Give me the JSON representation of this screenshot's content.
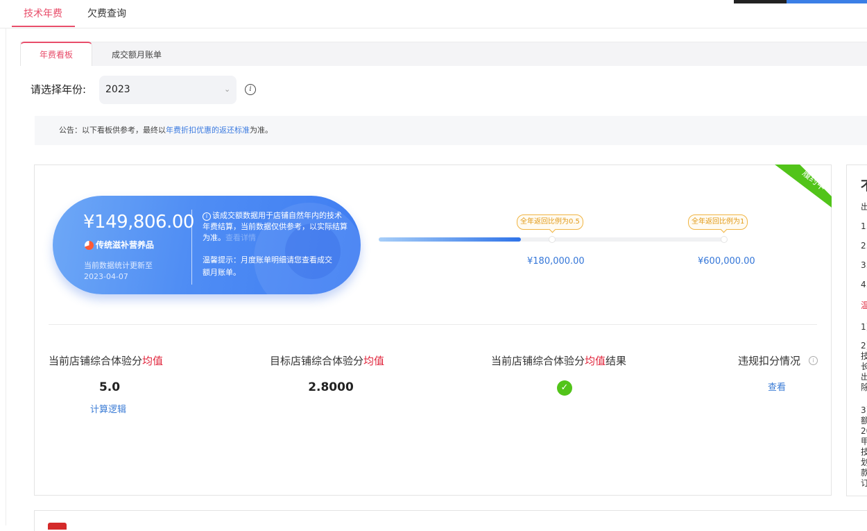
{
  "tabs": {
    "main": [
      {
        "label": "技术年费",
        "active": true
      },
      {
        "label": "欠费查询",
        "active": false
      }
    ],
    "sub": [
      {
        "label": "年费看板",
        "active": true
      },
      {
        "label": "成交额月账单",
        "active": false
      }
    ]
  },
  "year_filter": {
    "label": "请选择年份:",
    "value": "2023"
  },
  "notice": {
    "prefix": "公告：以下看板供参考，最终以",
    "link": "年费折扣优惠的返还标准",
    "suffix": "为准。"
  },
  "status_ribbon": "履约中",
  "summary": {
    "amount": "¥149,806.00",
    "brand": "传统滋补营养品",
    "update_label": "当前数据统计更新至",
    "update_date": "2023-04-07",
    "note_main": "该成交额数据用于店铺自然年内的技术年费结算，当前数据仅供参考，以实际结算为准。",
    "note_faint": "查看详情",
    "tip": "温馨提示：月度账单明细请您查看成交额月账单。"
  },
  "progress": {
    "fill_fraction": 0.41,
    "milestones": [
      {
        "badge": "全年返回比例为0.5",
        "amount": "¥180,000.00"
      },
      {
        "badge": "全年返回比例为1",
        "amount": "¥600,000.00"
      }
    ]
  },
  "metrics": {
    "current": {
      "label_prefix": "当前店铺综合体验分",
      "label_highlight": "均值",
      "value": "5.0",
      "link": "计算逻辑"
    },
    "target": {
      "label_prefix": "目标店铺综合体验分",
      "label_highlight": "均值",
      "value": "2.8000"
    },
    "result": {
      "label_prefix": "当前店铺综合体验分",
      "label_highlight": "均值",
      "label_suffix": "结果",
      "status": "passed"
    },
    "violation": {
      "label": "违规扣分情况",
      "link": "查看"
    }
  },
  "right_panel": {
    "lines": [
      "不",
      "出",
      "1.",
      "2.",
      "3.",
      "4.",
      "温",
      "1)",
      "2)",
      "技",
      "长",
      "出",
      "除",
      "3)",
      "额",
      "20",
      "甲",
      "技",
      "划",
      "款",
      "订"
    ]
  },
  "colors": {
    "accent": "#e84d6a",
    "link": "#3c7be0",
    "highlight": "#e0243b",
    "badge": "#e29a17",
    "ribbon": "#52c41a"
  }
}
